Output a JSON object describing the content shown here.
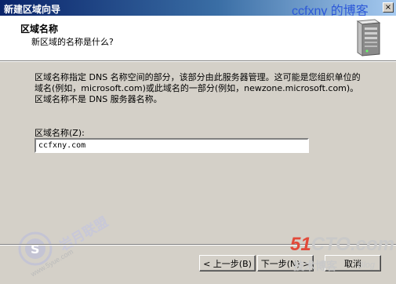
{
  "window": {
    "title": "新建区域向导",
    "watermark": "ccfxny 的博客",
    "close_glyph": "×"
  },
  "header": {
    "title": "区域名称",
    "subtitle": "新区域的名称是什么?"
  },
  "body": {
    "description": "区域名称指定 DNS 名称空间的部分，该部分由此服务器管理。这可能是您组织单位的域名(例如，microsoft.com)或此域名的一部分(例如，newzone.microsoft.com)。区域名称不是 DNS 服务器名称。",
    "zone_name_label": "区域名称(Z):",
    "zone_name_value": "ccfxny.com"
  },
  "buttons": {
    "back": "< 上一步(B)",
    "next": "下一步(N) >",
    "cancel": "取消"
  },
  "overlay": {
    "left_logo_text": "岩月联盟",
    "left_logo_url": "www.5yue.com",
    "right_logo_brand_a": "51",
    "right_logo_brand_b": "CTO",
    "right_logo_brand_c": ".com",
    "right_logo_sub": "技术博客",
    "right_logo_blog": "Blog"
  }
}
